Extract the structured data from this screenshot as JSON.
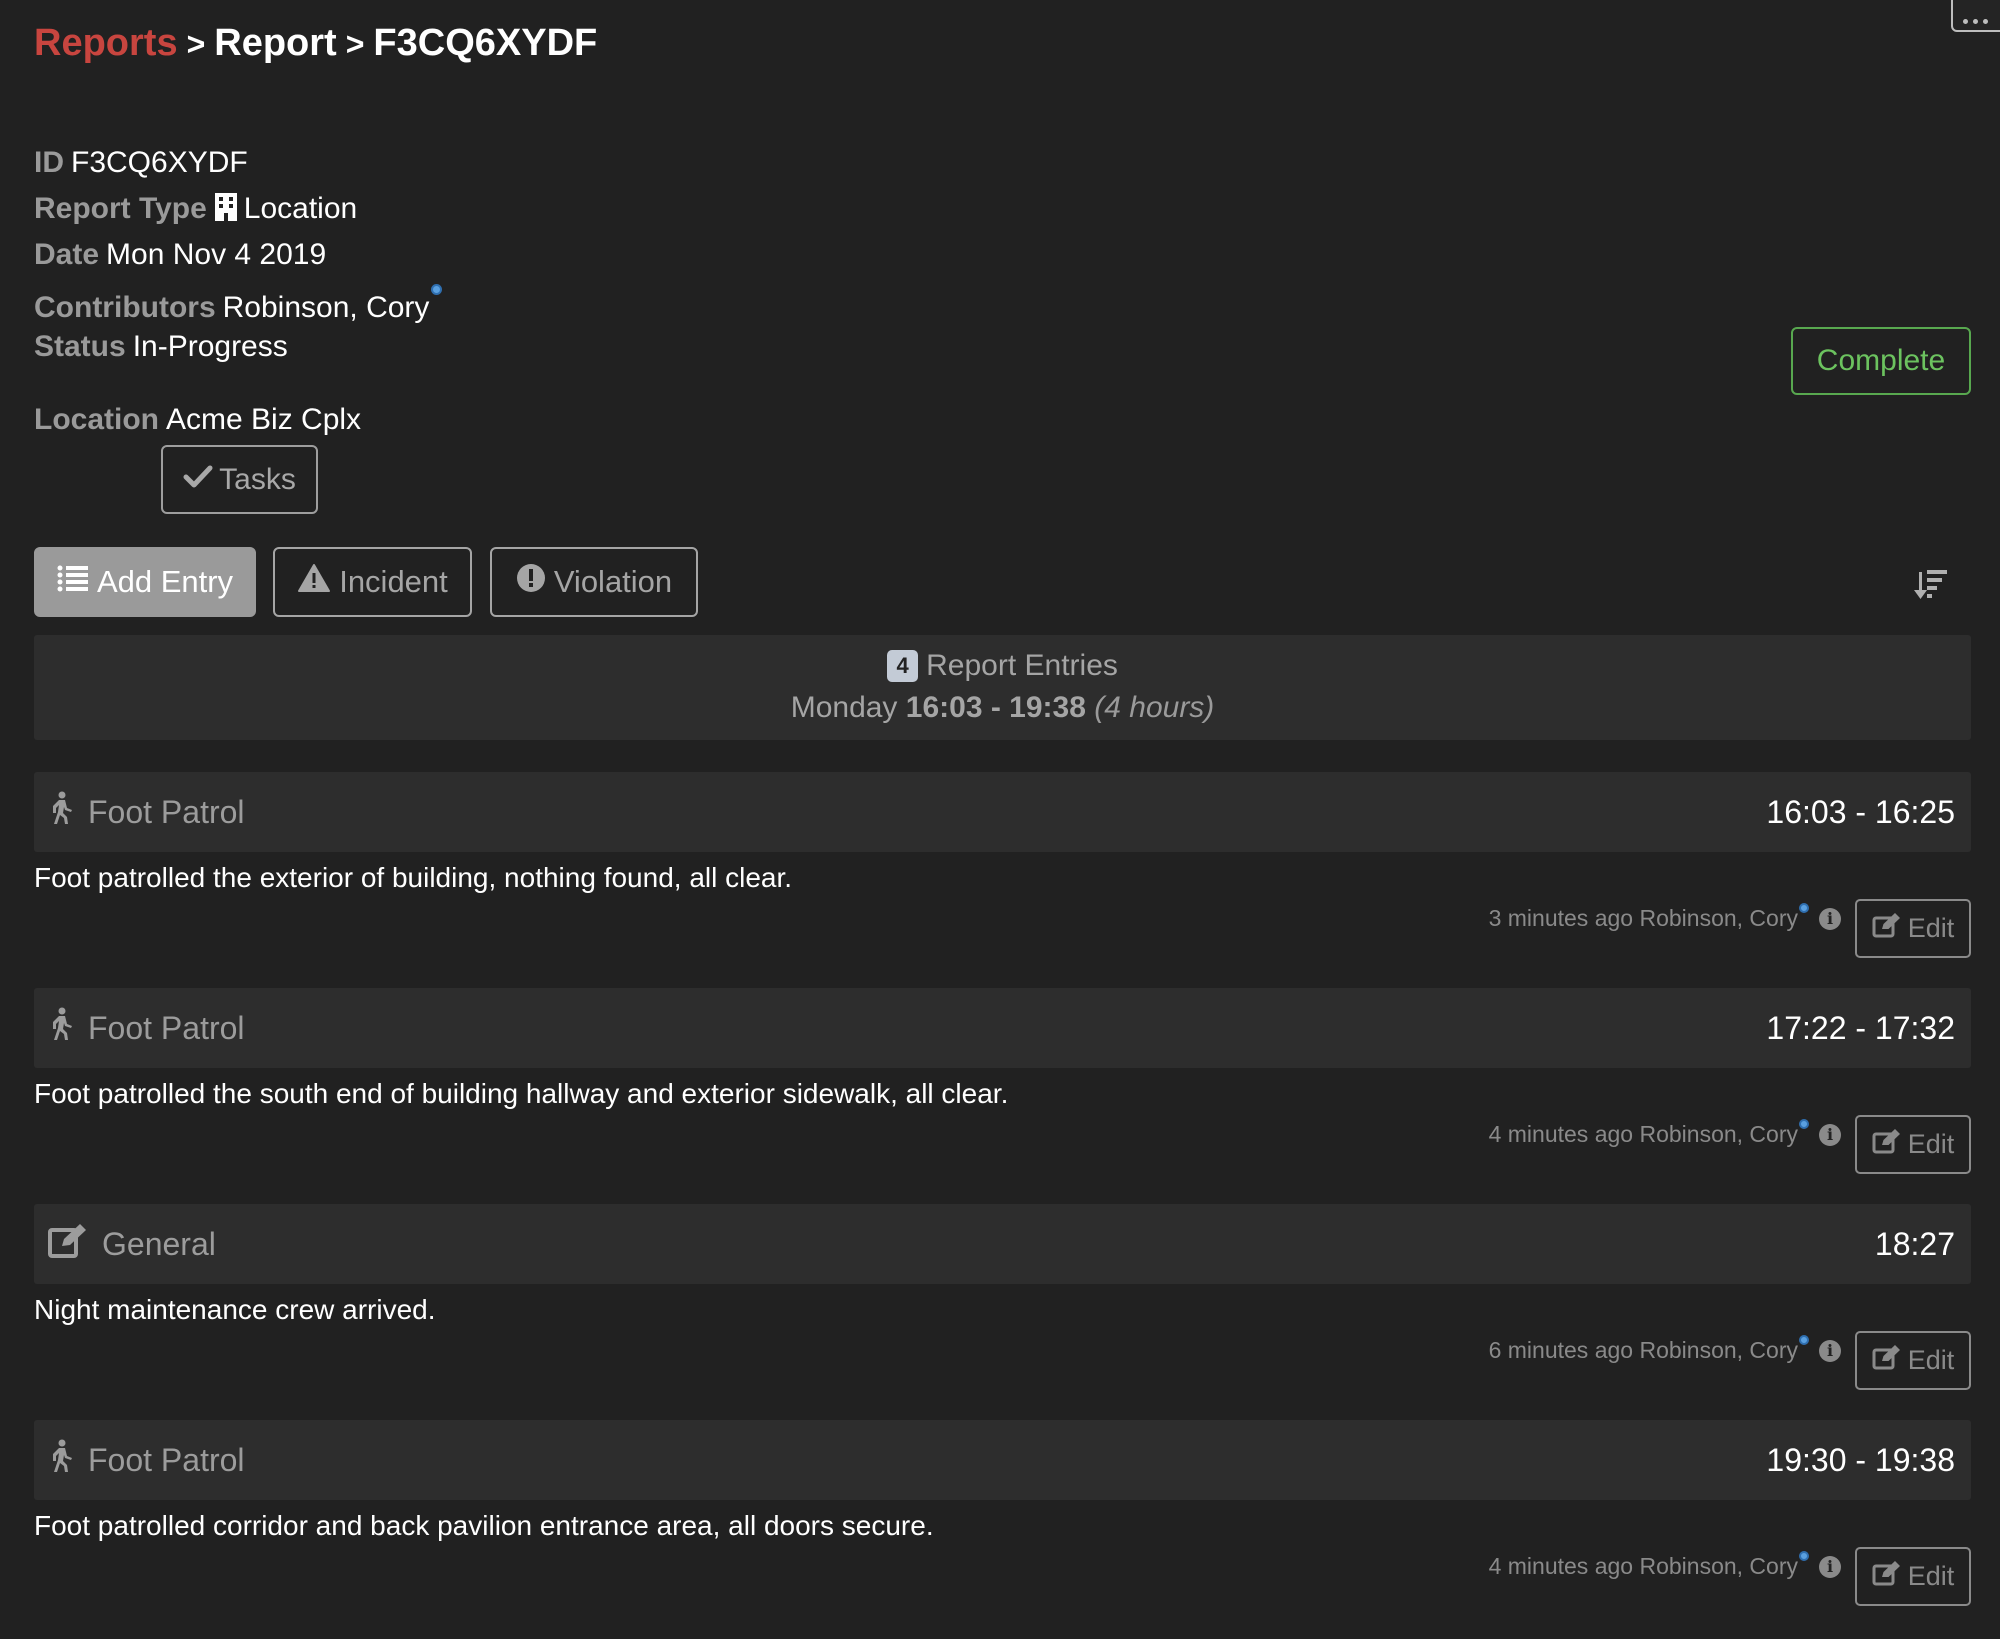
{
  "breadcrumb": {
    "items": [
      "Reports",
      "Report",
      "F3CQ6XYDF"
    ],
    "separator": ">"
  },
  "report": {
    "id_label": "ID",
    "id_value": "F3CQ6XYDF",
    "type_label": "Report Type",
    "type_icon": "building-icon",
    "type_value": "Location",
    "date_label": "Date",
    "date_value": "Mon Nov 4 2019",
    "contributors_label": "Contributors",
    "contributors_value": "Robinson, Cory",
    "status_label": "Status",
    "status_value": "In-Progress",
    "location_label": "Location",
    "location_value": "Acme Biz Cplx"
  },
  "buttons": {
    "complete": "Complete",
    "tasks": "Tasks",
    "add_entry": "Add Entry",
    "incident": "Incident",
    "violation": "Violation",
    "sort_icon": "sort-descending-icon",
    "more_icon": "more-dots-icon"
  },
  "colors": {
    "brand_link": "#c8453f",
    "complete": "#6cc35f",
    "background": "#212121",
    "panel": "#2d2d2d"
  },
  "summary": {
    "count": "4",
    "title": "Report Entries",
    "day": "Monday",
    "range": "16:03 - 19:38",
    "duration": "(4 hours)"
  },
  "entries": [
    {
      "type": "Foot Patrol",
      "icon": "walking-icon",
      "time": "16:03 - 16:25",
      "text": "Foot patrolled the exterior of building, nothing found, all clear.",
      "ago": "3 minutes ago",
      "author": "Robinson, Cory",
      "edit": "Edit"
    },
    {
      "type": "Foot Patrol",
      "icon": "walking-icon",
      "time": "17:22 - 17:32",
      "text": "Foot patrolled the south end of building hallway and exterior sidewalk, all clear.",
      "ago": "4 minutes ago",
      "author": "Robinson, Cory",
      "edit": "Edit"
    },
    {
      "type": "General",
      "icon": "edit-icon",
      "time": "18:27",
      "text": "Night maintenance crew arrived.",
      "ago": "6 minutes ago",
      "author": "Robinson, Cory",
      "edit": "Edit"
    },
    {
      "type": "Foot Patrol",
      "icon": "walking-icon",
      "time": "19:30 - 19:38",
      "text": "Foot patrolled corridor and back pavilion entrance area, all doors secure.",
      "ago": "4 minutes ago",
      "author": "Robinson, Cory",
      "edit": "Edit"
    }
  ]
}
